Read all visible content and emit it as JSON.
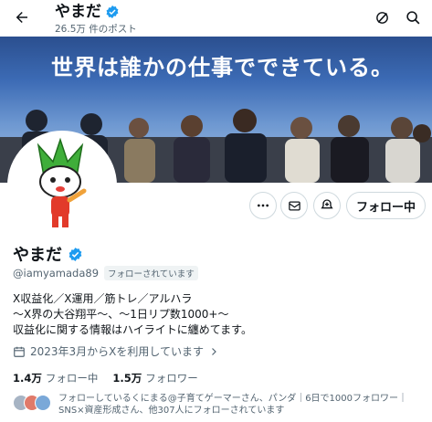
{
  "header": {
    "name": "やまだ",
    "post_count": "26.5万 件のポスト"
  },
  "banner": {
    "headline": "世界は誰かの仕事でできている。"
  },
  "profile": {
    "name": "やまだ",
    "handle": "@iamyamada89",
    "follows_you": "フォローされています",
    "bio_lines": [
      "X収益化／X運用／筋トレ／アルハラ",
      "〜X界の大谷翔平〜、〜1日リプ数1000+〜",
      "収益化に関する情報はハイライトに纏めてます。"
    ],
    "joined": "2023年3月からXを利用しています"
  },
  "actions": {
    "follow_label": "フォロー中"
  },
  "stats": {
    "following_count": "1.4万",
    "following_label": "フォロー中",
    "followers_count": "1.5万",
    "followers_label": "フォロワー"
  },
  "followed_by": {
    "line1": "フォローしているくにまる@子育てゲーマーさん、パンダ｜6日で1000フォロワー｜",
    "line2": "SNS×資産形成さん、他307人にフォローされています"
  },
  "icons": {
    "back": "arrow-left-icon",
    "verified": "verified-badge-icon",
    "grok": "grok-icon",
    "search": "search-icon",
    "more": "more-icon",
    "message": "mail-icon",
    "subscribe": "subscribe-icon",
    "calendar": "calendar-icon"
  },
  "colors": {
    "verified": "#1d9bf0",
    "text": "#0f1419",
    "secondary": "#536471"
  }
}
